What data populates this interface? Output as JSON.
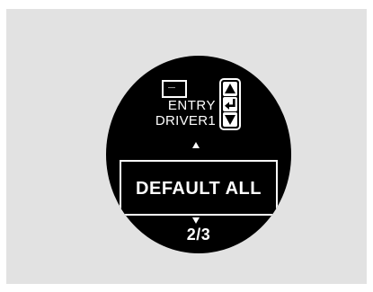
{
  "screen": {
    "mode_label": "ENTRY",
    "profile_label": "DRIVER1",
    "menu_item": "DEFAULT ALL",
    "page_indicator": "2/3"
  },
  "icons": {
    "entry": "screen-entry-icon",
    "control_up": "arrow-up-icon",
    "control_enter": "enter-icon",
    "control_down": "arrow-down-icon",
    "scroll_up": "caret-up-icon",
    "scroll_down": "caret-down-icon"
  },
  "colors": {
    "background": "#e2e2e2",
    "display": "#000000",
    "foreground": "#ffffff"
  }
}
